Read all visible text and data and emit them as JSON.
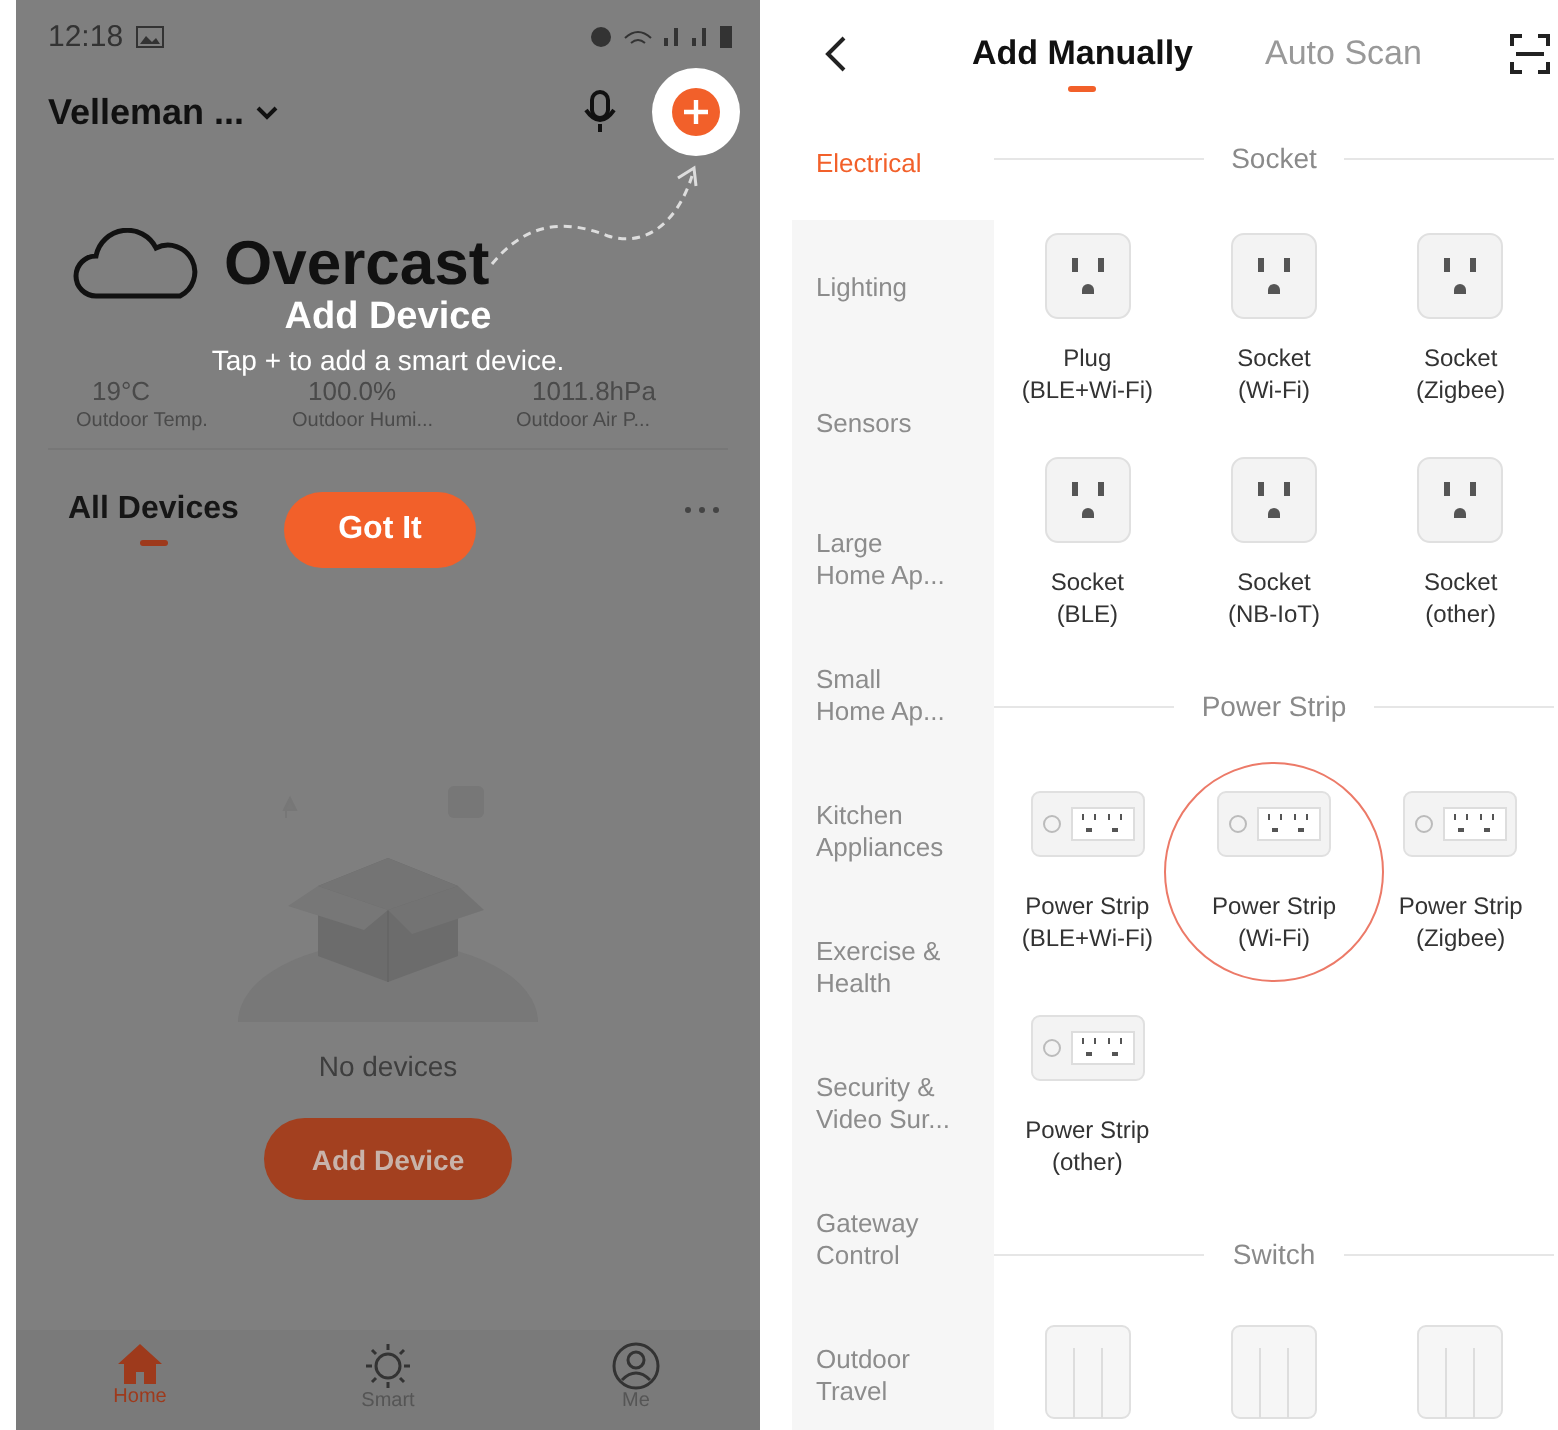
{
  "home_screen": {
    "status_bar": {
      "time": "12:18"
    },
    "header": {
      "home_name": "Velleman ..."
    },
    "weather": {
      "condition": "Overcast",
      "stats": [
        {
          "value": "19°C",
          "label": "Outdoor Temp."
        },
        {
          "value": "100.0%",
          "label": "Outdoor Humi..."
        },
        {
          "value": "1011.8hPa",
          "label": "Outdoor Air P..."
        }
      ]
    },
    "tabs": [
      {
        "label": "All Devices",
        "selected": true
      }
    ],
    "empty_state": {
      "message": "No devices",
      "button": "Add Device"
    },
    "nav": [
      {
        "kind": "home",
        "label": "Home",
        "selected": true
      },
      {
        "kind": "smart",
        "label": "Smart",
        "selected": false
      },
      {
        "kind": "me",
        "label": "Me",
        "selected": false
      }
    ],
    "guide": {
      "title": "Add Device",
      "text": "Tap + to add a smart device.",
      "button": "Got It"
    }
  },
  "add_device_screen": {
    "tabs": [
      {
        "label": "Add Manually",
        "selected": true
      },
      {
        "label": "Auto Scan",
        "selected": false
      }
    ],
    "categories": [
      {
        "lines": [
          "Electrical"
        ],
        "selected": true
      },
      {
        "lines": [
          "Lighting"
        ],
        "selected": false
      },
      {
        "lines": [
          "Sensors"
        ],
        "selected": false
      },
      {
        "lines": [
          "Large",
          "Home Ap..."
        ],
        "selected": false
      },
      {
        "lines": [
          "Small",
          "Home Ap..."
        ],
        "selected": false
      },
      {
        "lines": [
          "Kitchen",
          "Appliances"
        ],
        "selected": false
      },
      {
        "lines": [
          "Exercise &",
          "Health"
        ],
        "selected": false
      },
      {
        "lines": [
          "Security &",
          "Video Sur..."
        ],
        "selected": false
      },
      {
        "lines": [
          "Gateway",
          "Control"
        ],
        "selected": false
      },
      {
        "lines": [
          "Outdoor",
          "Travel"
        ],
        "selected": false
      }
    ],
    "sections": [
      {
        "title": "Socket",
        "kind": "socket",
        "items": [
          {
            "name": "Plug",
            "variant": "(BLE+Wi-Fi)",
            "highlighted": false
          },
          {
            "name": "Socket",
            "variant": "(Wi-Fi)",
            "highlighted": false
          },
          {
            "name": "Socket",
            "variant": "(Zigbee)",
            "highlighted": false
          },
          {
            "name": "Socket",
            "variant": "(BLE)",
            "highlighted": false
          },
          {
            "name": "Socket",
            "variant": "(NB-IoT)",
            "highlighted": false
          },
          {
            "name": "Socket",
            "variant": "(other)",
            "highlighted": false
          }
        ]
      },
      {
        "title": "Power Strip",
        "kind": "strip",
        "items": [
          {
            "name": "Power Strip",
            "variant": "(BLE+Wi-Fi)",
            "highlighted": false
          },
          {
            "name": "Power Strip",
            "variant": "(Wi-Fi)",
            "highlighted": true
          },
          {
            "name": "Power Strip",
            "variant": "(Zigbee)",
            "highlighted": false
          },
          {
            "name": "Power Strip",
            "variant": "(other)",
            "highlighted": false
          }
        ]
      },
      {
        "title": "Switch",
        "kind": "switch",
        "items": [
          {
            "highlighted": false
          },
          {
            "highlighted": false
          },
          {
            "highlighted": false
          }
        ]
      }
    ]
  }
}
